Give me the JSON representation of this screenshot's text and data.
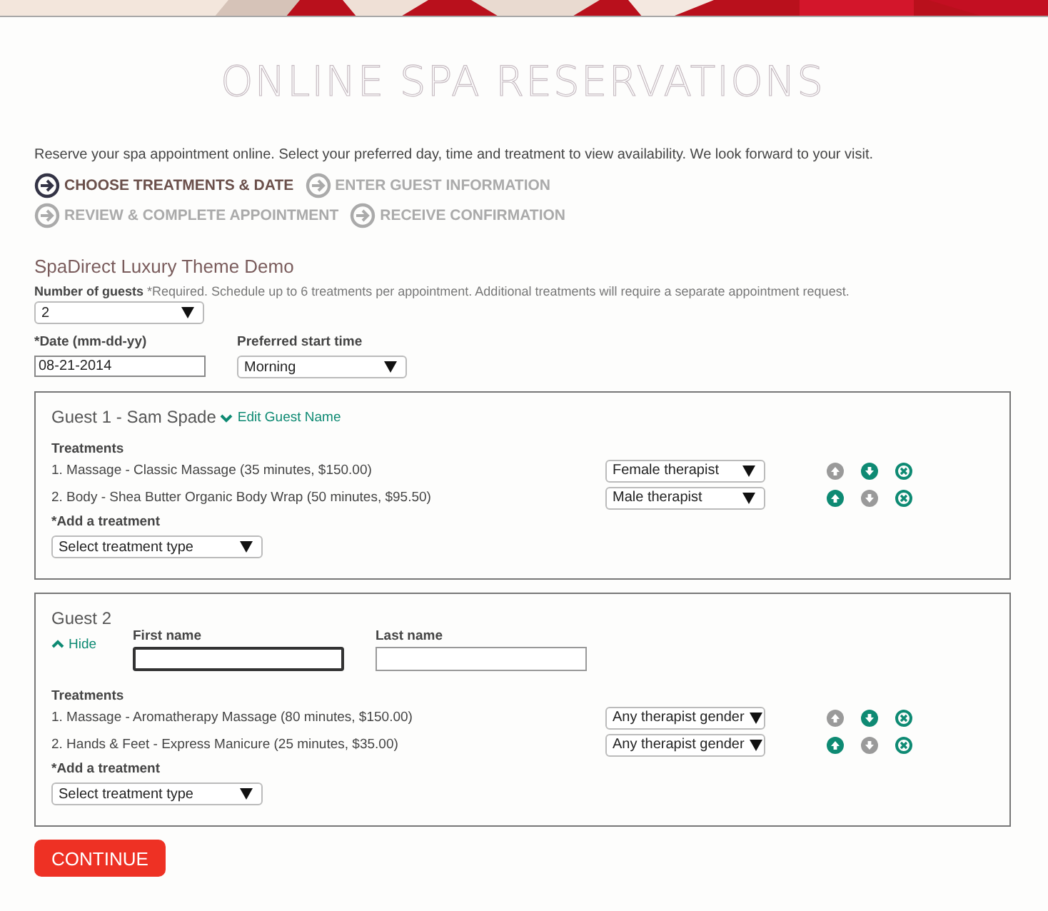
{
  "title": "ONLINE SPA RESERVATIONS",
  "intro": "Reserve your spa appointment online. Select your preferred day, time and treatment to view availability. We look forward to your visit.",
  "steps": [
    {
      "label": "CHOOSE TREATMENTS & DATE",
      "selected": true
    },
    {
      "label": "ENTER GUEST INFORMATION",
      "selected": false
    },
    {
      "label": "REVIEW & COMPLETE APPOINTMENT",
      "selected": false
    },
    {
      "label": "RECEIVE CONFIRMATION",
      "selected": false
    }
  ],
  "form_title": "SpaDirect Luxury Theme Demo",
  "guests_field": {
    "label": "Number of guests",
    "note": "*Required. Schedule up to 6 treatments per appointment. Additional treatments will require a separate appointment request.",
    "value": "2"
  },
  "date_field": {
    "label": "*Date (mm-dd-yy)",
    "value": "08-21-2014"
  },
  "time_field": {
    "label": "Preferred start time",
    "value": "Morning"
  },
  "guests": [
    {
      "title": "Guest 1 - Sam Spade",
      "toggle": "Edit Guest Name",
      "expanded": false,
      "treatments_label": "Treatments",
      "treatments": [
        {
          "text": "1. Massage - Classic Massage (35 minutes, $150.00)",
          "therapist": "Female therapist",
          "can_move_up": false,
          "can_move_down": true
        },
        {
          "text": "2. Body - Shea Butter Organic Body Wrap (50 minutes, $95.50)",
          "therapist": "Male therapist",
          "can_move_up": true,
          "can_move_down": false
        }
      ],
      "add_label": "*Add a treatment",
      "add_select": "Select treatment type"
    },
    {
      "title": "Guest 2",
      "toggle": "Hide",
      "expanded": true,
      "first_name": {
        "label": "First name",
        "focused": true
      },
      "last_name": {
        "label": "Last name",
        "focused": false
      },
      "treatments_label": "Treatments",
      "treatments": [
        {
          "text": "1. Massage - Aromatherapy Massage (80 minutes, $150.00)",
          "therapist": "Any therapist gender",
          "can_move_up": false,
          "can_move_down": true
        },
        {
          "text": "2. Hands & Feet - Express Manicure (25 minutes, $35.00)",
          "therapist": "Any therapist gender",
          "can_move_up": true,
          "can_move_down": false
        }
      ],
      "add_label": "*Add a treatment",
      "add_select": "Select treatment type"
    }
  ],
  "continue_button": "CONTINUE"
}
